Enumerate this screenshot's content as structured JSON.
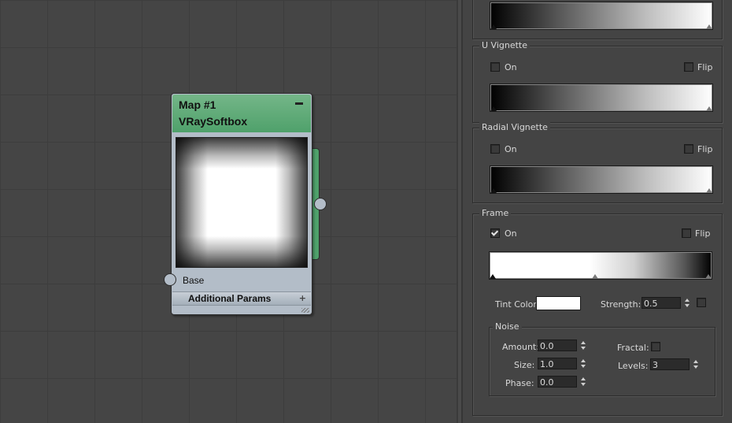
{
  "node": {
    "line1": "Map #1",
    "line2": "VRaySoftbox",
    "input_port": "Base",
    "rollout": "Additional Params"
  },
  "u_vignette": {
    "title": "U Vignette",
    "on": "On",
    "flip": "Flip",
    "on_checked": false,
    "flip_checked": false
  },
  "radial_vignette": {
    "title": "Radial Vignette",
    "on": "On",
    "flip": "Flip",
    "on_checked": false,
    "flip_checked": false
  },
  "frame": {
    "title": "Frame",
    "on": "On",
    "flip": "Flip",
    "on_checked": true,
    "flip_checked": false,
    "tint_color_label": "Tint Color:",
    "tint_color": "#ffffff",
    "strength_label": "Strength:",
    "strength_value": "0.5"
  },
  "noise": {
    "title": "Noise",
    "amount_label": "Amount:",
    "amount_value": "0.0",
    "size_label": "Size:",
    "size_value": "1.0",
    "phase_label": "Phase:",
    "phase_value": "0.0",
    "fractal_label": "Fractal:",
    "levels_label": "Levels:",
    "levels_value": "3"
  },
  "colors": {
    "node_header": "#5aa874",
    "node_body": "#b3bdc8",
    "canvas": "#454545",
    "panel": "#444444"
  }
}
